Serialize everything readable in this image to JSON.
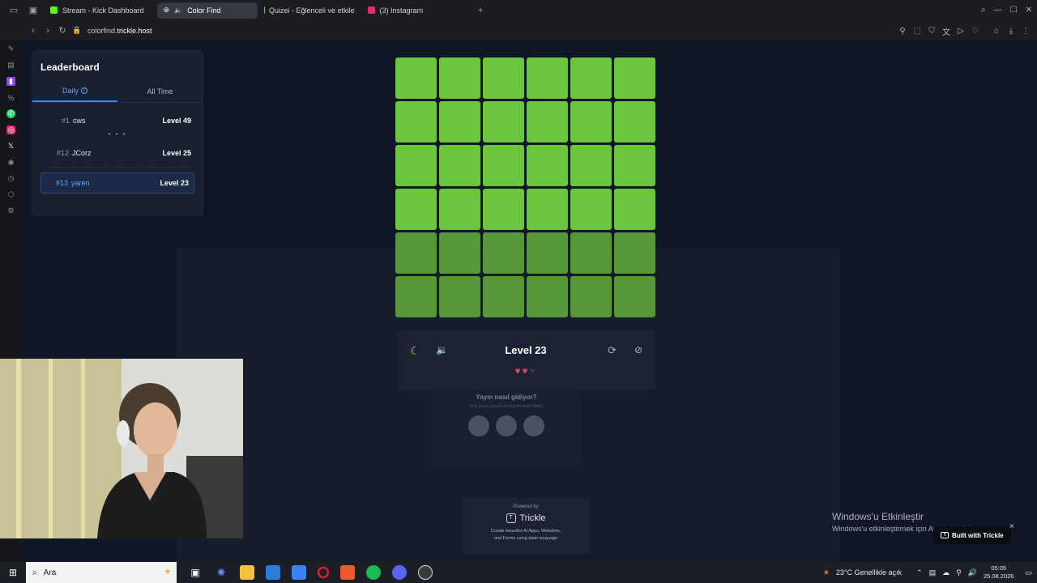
{
  "browser": {
    "tabs": [
      {
        "label": "Stream - Kick Dashboard",
        "color": "#53fc18"
      },
      {
        "label": "Color Find",
        "color": "#ffffff",
        "active": true
      },
      {
        "label": "Quizei - Eğlenceli ve etkile",
        "color": "#8bc34a"
      },
      {
        "label": "(3) Instagram",
        "color": "#e1306c"
      }
    ],
    "new_tab": "+",
    "url_prefix": "colorfind.",
    "url_domain": "trickle.host"
  },
  "leaderboard": {
    "title": "Leaderboard",
    "tabs": {
      "daily": "Daily",
      "all_time": "All Time"
    },
    "rows": [
      {
        "rank": "#1",
        "name": "cws",
        "level": "Level 49"
      },
      {
        "rank": "#12",
        "name": "JCorz",
        "level": "Level 25"
      },
      {
        "rank": "#13",
        "name": "yaren",
        "level": "Level 23"
      }
    ],
    "dots": "• • •"
  },
  "game": {
    "level_label": "Level 23",
    "lives_total": 3,
    "lives_remaining": 2,
    "grid_color": "#6cc43f"
  },
  "feedback": {
    "question": "Yayın nasıl gidiyor?",
    "subtitle": "Bize yayın yayınla deneyimlerinizi bildirin"
  },
  "powered": {
    "label": "Powered by",
    "brand": "Trickle",
    "desc_line1": "Create beautiful AI Apps, Websites,",
    "desc_line2": "and Forms using plain language"
  },
  "watermark": {
    "title": "Windows'u Etkinleştir",
    "subtitle": "Windows'u etkinleştirmek için Ayarlar'a gidin."
  },
  "built_badge": "Built with Trickle",
  "taskbar": {
    "search_placeholder": "Ara",
    "weather": "23°C  Genellikle açık",
    "time": "05:05",
    "date": "25.08.2026"
  }
}
